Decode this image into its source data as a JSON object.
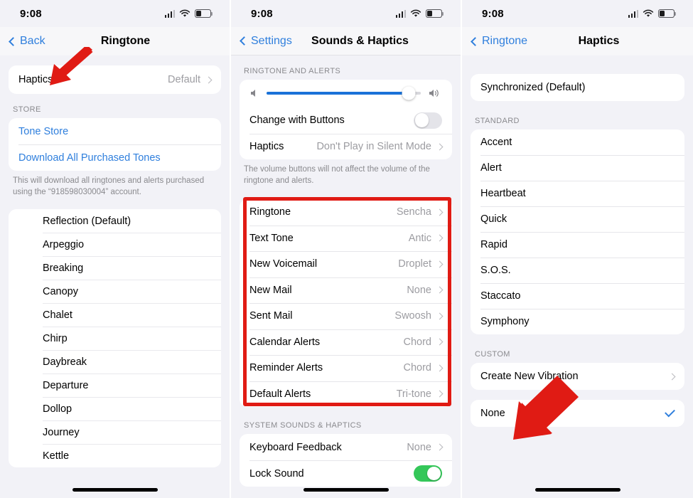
{
  "accent": "#2f7fdd",
  "annotation_color": "#e01b14",
  "panel1": {
    "status": {
      "time": "9:08",
      "signal_icon": "cellular-bars-icon",
      "wifi_icon": "wifi-icon",
      "battery_icon": "battery-icon"
    },
    "nav": {
      "back_label": "Back",
      "title": "Ringtone"
    },
    "haptics_row": {
      "label": "Haptics",
      "value": "Default"
    },
    "store_header": "STORE",
    "store_items": [
      {
        "label": "Tone Store"
      },
      {
        "label": "Download All Purchased Tones"
      }
    ],
    "store_footnote": "This will download all ringtones and alerts purchased using the “918598030004” account.",
    "tones": [
      "Reflection (Default)",
      "Arpeggio",
      "Breaking",
      "Canopy",
      "Chalet",
      "Chirp",
      "Daybreak",
      "Departure",
      "Dollop",
      "Journey",
      "Kettle"
    ]
  },
  "panel2": {
    "status": {
      "time": "9:08",
      "signal_icon": "cellular-bars-icon",
      "wifi_icon": "wifi-icon",
      "battery_icon": "battery-icon"
    },
    "nav": {
      "back_label": "Settings",
      "title": "Sounds & Haptics"
    },
    "ringtone_alerts_header": "RINGTONE AND ALERTS",
    "volume": {
      "value_percent": 92,
      "low_icon": "speaker-low-icon",
      "high_icon": "speaker-high-icon"
    },
    "change_with_buttons": {
      "label": "Change with Buttons",
      "state": "off"
    },
    "haptics_row": {
      "label": "Haptics",
      "value": "Don't Play in Silent Mode"
    },
    "footnote": "The volume buttons will not affect the volume of the ringtone and alerts.",
    "tone_rows": [
      {
        "label": "Ringtone",
        "value": "Sencha"
      },
      {
        "label": "Text Tone",
        "value": "Antic"
      },
      {
        "label": "New Voicemail",
        "value": "Droplet"
      },
      {
        "label": "New Mail",
        "value": "None"
      },
      {
        "label": "Sent Mail",
        "value": "Swoosh"
      },
      {
        "label": "Calendar Alerts",
        "value": "Chord"
      },
      {
        "label": "Reminder Alerts",
        "value": "Chord"
      },
      {
        "label": "Default Alerts",
        "value": "Tri-tone"
      }
    ],
    "system_header": "SYSTEM SOUNDS & HAPTICS",
    "system_rows": [
      {
        "label": "Keyboard Feedback",
        "value": "None",
        "type": "disclosure"
      },
      {
        "label": "Lock Sound",
        "value": "",
        "type": "toggle",
        "state": "on"
      }
    ]
  },
  "panel3": {
    "status": {
      "time": "9:08",
      "signal_icon": "cellular-bars-icon",
      "wifi_icon": "wifi-icon",
      "battery_icon": "battery-icon"
    },
    "nav": {
      "back_label": "Ringtone",
      "title": "Haptics"
    },
    "synchronized_row": {
      "label": "Synchronized (Default)"
    },
    "standard_header": "STANDARD",
    "standard_items": [
      "Accent",
      "Alert",
      "Heartbeat",
      "Quick",
      "Rapid",
      "S.O.S.",
      "Staccato",
      "Symphony"
    ],
    "custom_header": "CUSTOM",
    "create_new_vibration": {
      "label": "Create New Vibration"
    },
    "none_row": {
      "label": "None",
      "selected": true
    }
  }
}
